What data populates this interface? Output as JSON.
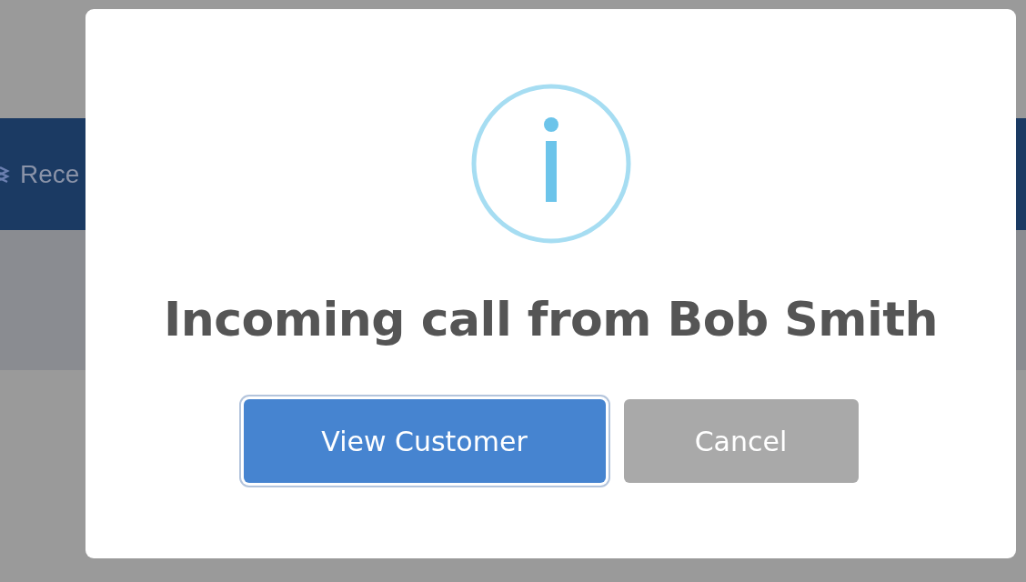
{
  "background": {
    "banner_text": "Rece"
  },
  "dialog": {
    "title": "Incoming call from Bob Smith",
    "buttons": [
      {
        "label": "View Customer",
        "kind": "primary",
        "focused": true
      },
      {
        "label": "Cancel",
        "kind": "secondary",
        "focused": false
      }
    ]
  }
}
